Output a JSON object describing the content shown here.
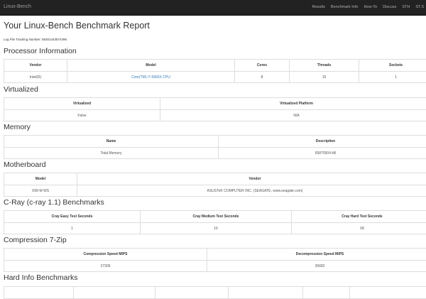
{
  "nav": {
    "brand": "Linux-Bench",
    "links": [
      "Results",
      "Benchmark Info",
      "How-To",
      "Discuss",
      "STH",
      "ST.S"
    ]
  },
  "title": "Your Linux-Bench Benchmark Report",
  "log": "Log File Tracking Number: 56301443574496",
  "processor": {
    "heading": "Processor Information",
    "headers": [
      "Vendor",
      "Model",
      "Cores",
      "Threads",
      "Sockets"
    ],
    "values": [
      "Intel(R)",
      "Core(TM) i7-5960X CPU",
      "8",
      "16",
      "1"
    ]
  },
  "virtualized": {
    "heading": "Virtualized",
    "headers": [
      "Virtualized",
      "Virtualized Platform"
    ],
    "values": [
      "False",
      "N/A"
    ]
  },
  "memory": {
    "heading": "Memory",
    "headers": [
      "Name",
      "Description"
    ],
    "values": [
      "Total Memory",
      "65875504 kB"
    ]
  },
  "motherboard": {
    "heading": "Motherboard",
    "headers": [
      "Model",
      "Vendor"
    ],
    "values": [
      "X99-M WS",
      "ASUSTeK COMPUTER INC. (SEAGATE, www.seagate.com)"
    ]
  },
  "cray": {
    "heading": "C-Ray (c-ray 1.1) Benchmarks",
    "headers": [
      "Cray Easy Test Seconds",
      "Cray Medium Test Seconds",
      "Cray Hard Test Seconds"
    ],
    "values": [
      "1",
      "16",
      "58"
    ]
  },
  "zip": {
    "heading": "Compression 7-Zip",
    "headers": [
      "Compression Speed MIPS",
      "Decompression Speed MIPS"
    ],
    "values": [
      "37309",
      "35682"
    ]
  },
  "hardinfo": {
    "heading": "Hard Info Benchmarks"
  }
}
